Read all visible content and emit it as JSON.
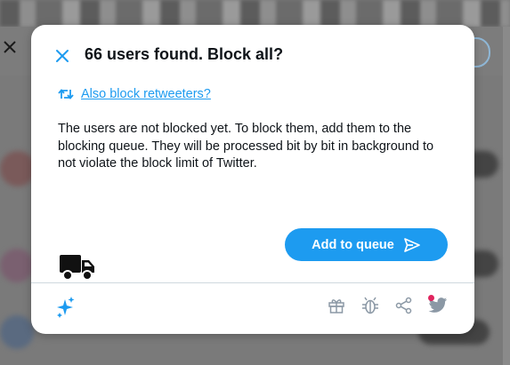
{
  "modal": {
    "title": "66 users found. Block all?",
    "retweeters_link": "Also block retweeters?",
    "description": "The users are not blocked yet. To block them, add them to the blocking queue. They will be processed bit by bit in background to not violate the block limit of Twitter.",
    "queue_button_label": "Add to queue"
  },
  "colors": {
    "accent": "#1d9bf0",
    "notification_dot": "#e0245e"
  },
  "icons": {
    "close": "close-icon",
    "retweet": "retweet-icon",
    "send": "send-icon",
    "truck": "truck-icon",
    "sparkle": "sparkle-icon",
    "gift": "gift-icon",
    "bug": "bug-icon",
    "share": "share-icon",
    "twitter": "twitter-bird-icon"
  }
}
